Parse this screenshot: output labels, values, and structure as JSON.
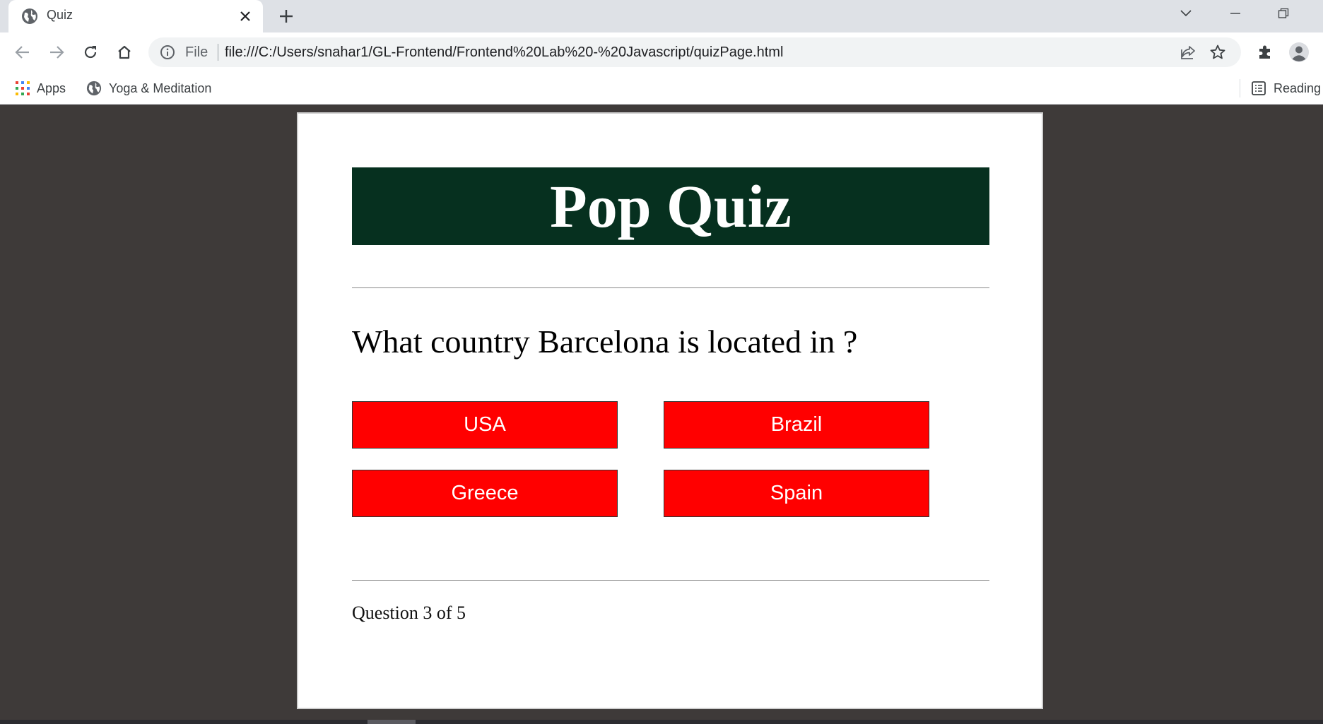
{
  "browser": {
    "tab": {
      "title": "Quiz",
      "favicon": "globe-icon"
    },
    "address": {
      "scheme_chip": "File",
      "url": "file:///C:/Users/snahar1/GL-Frontend/Frontend%20Lab%20-%20Javascript/quizPage.html"
    },
    "bookmarks": [
      {
        "label": "Apps",
        "icon": "apps-grid-icon"
      },
      {
        "label": "Yoga & Meditation",
        "icon": "globe-icon"
      }
    ],
    "reading_list": {
      "label": "Reading",
      "icon": "reading-list-icon"
    }
  },
  "quiz": {
    "title": "Pop Quiz",
    "question": "What country Barcelona is located in ?",
    "choices": [
      "USA",
      "Brazil",
      "Greece",
      "Spain"
    ],
    "progress": "Question 3 of 5"
  },
  "colors": {
    "header_bg": "#06301f",
    "choice_bg": "#ff0000",
    "page_bg": "#3e3a39"
  }
}
